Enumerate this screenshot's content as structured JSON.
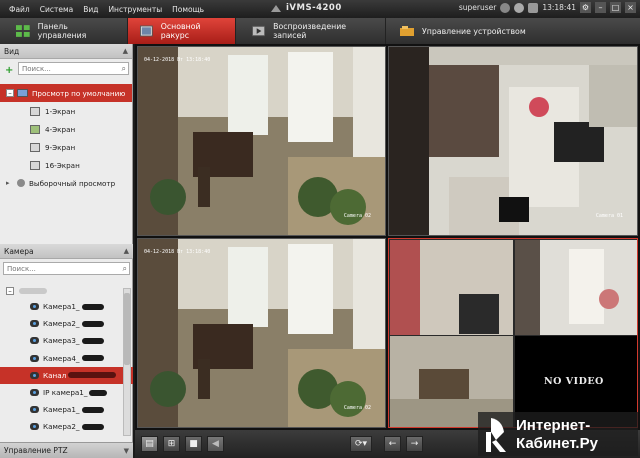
{
  "menu": {
    "items": [
      "Файл",
      "Система",
      "Вид",
      "Инструменты",
      "Помощь"
    ]
  },
  "app": {
    "title": "iVMS-4200"
  },
  "titlebar": {
    "user": "superuser",
    "time": "13:18:41"
  },
  "tabs": [
    {
      "label": "Панель управления"
    },
    {
      "label": "Основной ракурс"
    },
    {
      "label": "Воспроизведение записей"
    },
    {
      "label": "Управление устройством"
    }
  ],
  "view_panel": {
    "header": "Вид",
    "search_placeholder": "Поиск...",
    "default_view": "Просмотр по умолчанию",
    "layouts": [
      "1-Экран",
      "4-Экран",
      "9-Экран",
      "16-Экран"
    ],
    "custom_view": "Выборочный просмотр"
  },
  "camera_panel": {
    "header": "Камера",
    "search_placeholder": "Поиск...",
    "cameras": [
      {
        "label": "Камера1_"
      },
      {
        "label": "Камера2_"
      },
      {
        "label": "Камера3_"
      },
      {
        "label": "Камера4_"
      },
      {
        "label": "Канал "
      },
      {
        "label": "IP камера1_"
      },
      {
        "label": "Камера1_"
      },
      {
        "label": "Камера2_"
      }
    ]
  },
  "ptz_panel": {
    "header": "Управление PTZ"
  },
  "video": {
    "timestamps": [
      "04-12-2018 Вт 13:18:40",
      "04-12-2018 Вт 13:18:40"
    ],
    "camera_labels": [
      "Camera 02",
      "Camera 01",
      "Camera 02"
    ],
    "no_video": "NO VIDEO"
  },
  "watermark": {
    "line1": "Интернет-",
    "line2": "Кабинет.Ру"
  },
  "colors": {
    "accent": "#c63228",
    "toolbar": "#2e2e2e"
  }
}
